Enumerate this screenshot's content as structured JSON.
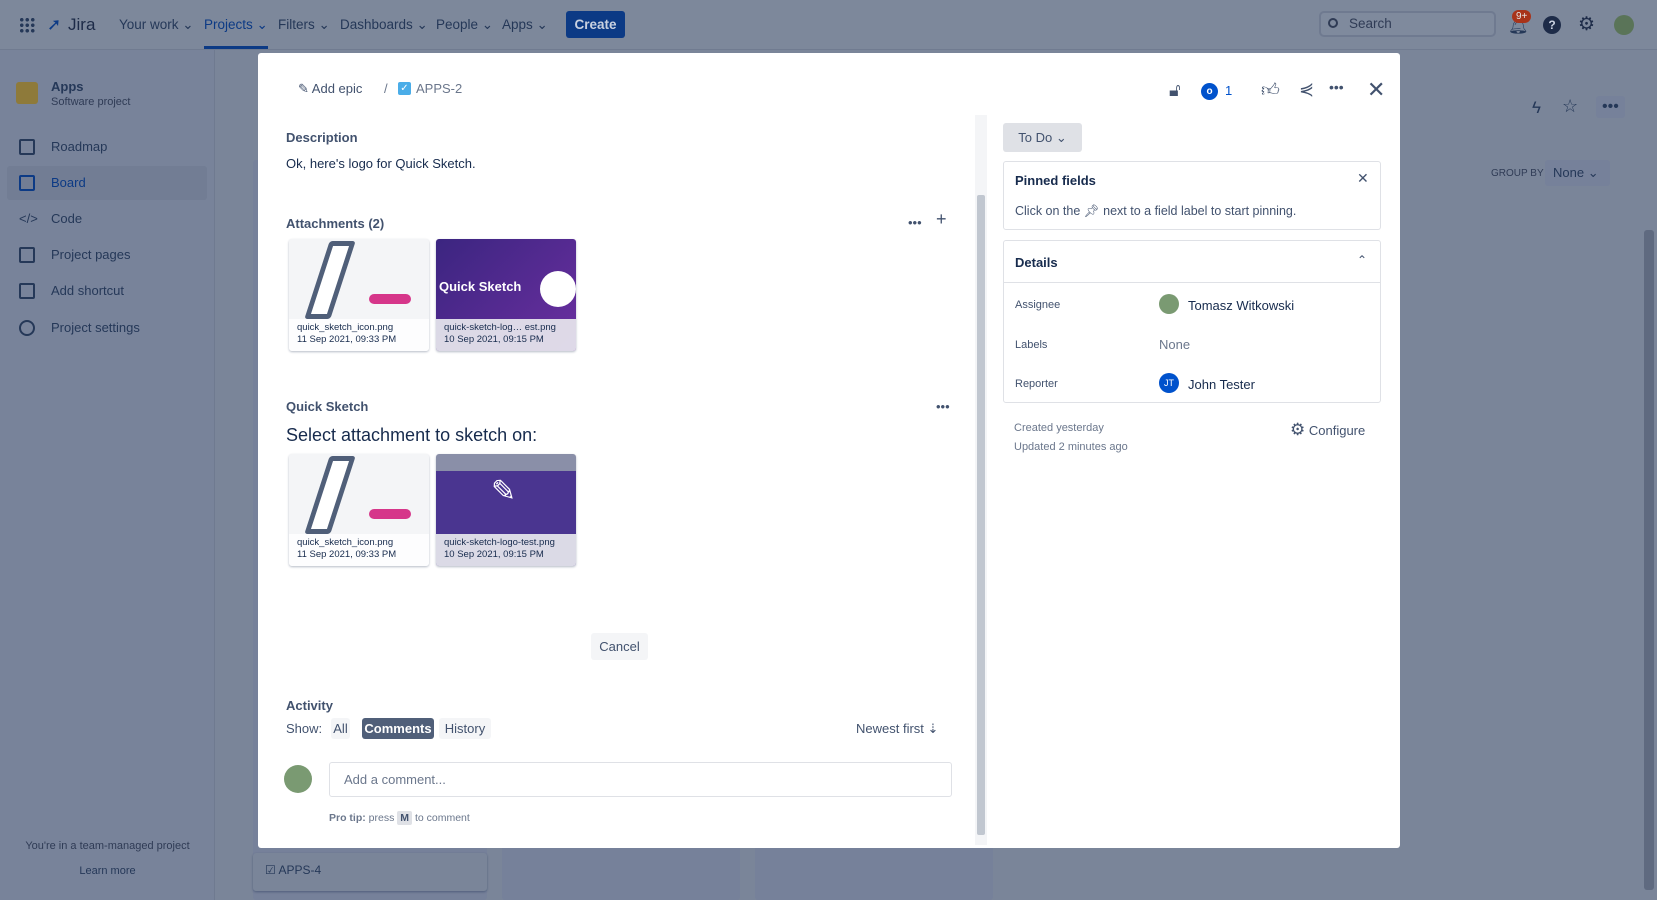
{
  "nav": {
    "logo": "Jira",
    "items": [
      "Your work",
      "Projects",
      "Filters",
      "Dashboards",
      "People",
      "Apps"
    ],
    "create": "Create",
    "search_placeholder": "Search",
    "notifications": "9+"
  },
  "sidebar": {
    "project_name": "Apps",
    "project_type": "Software project",
    "items": [
      "Roadmap",
      "Board",
      "Code",
      "Project pages",
      "Add shortcut",
      "Project settings"
    ],
    "footer": "You're in a team-managed project",
    "learn_more": "Learn more"
  },
  "board": {
    "group_by": "GROUP BY",
    "group_value": "None",
    "card": "APPS-4"
  },
  "issue": {
    "add_epic": "Add epic",
    "separator": "/",
    "key": "APPS-2",
    "watchers": "1",
    "description_label": "Description",
    "description": "Ok, here's logo for Quick Sketch.",
    "attachments_label": "Attachments (2)",
    "attachments": [
      {
        "name": "quick_sketch_icon.png",
        "date": "11 Sep 2021, 09:33 PM"
      },
      {
        "name": "quick-sketch-log… est.png",
        "date": "10 Sep 2021, 09:15 PM",
        "thumb_text": "Quick Sketch"
      }
    ],
    "quick_sketch_label": "Quick Sketch",
    "select_heading": "Select attachment to sketch on:",
    "sketch_attachments": [
      {
        "name": "quick_sketch_icon.png",
        "date": "11 Sep 2021, 09:33 PM"
      },
      {
        "name": "quick-sketch-logo-test.png",
        "date": "10 Sep 2021, 09:15 PM"
      }
    ],
    "cancel": "Cancel",
    "activity_label": "Activity",
    "show_label": "Show:",
    "filters": [
      "All",
      "Comments",
      "History"
    ],
    "sort": "Newest first",
    "comment_placeholder": "Add a comment...",
    "pro_tip_bold": "Pro tip:",
    "pro_tip_press": "press",
    "pro_tip_key": "M",
    "pro_tip_end": "to comment"
  },
  "panel": {
    "status": "To Do",
    "pinned_title": "Pinned fields",
    "pinned_text_a": "Click on the",
    "pinned_text_b": "next to a field label to start pinning.",
    "details_title": "Details",
    "fields": [
      {
        "label": "Assignee",
        "value": "Tomasz Witkowski"
      },
      {
        "label": "Labels",
        "value": "None"
      },
      {
        "label": "Reporter",
        "value": "John Tester",
        "initials": "JT"
      }
    ],
    "created": "Created yesterday",
    "updated": "Updated 2 minutes ago",
    "configure": "Configure"
  }
}
